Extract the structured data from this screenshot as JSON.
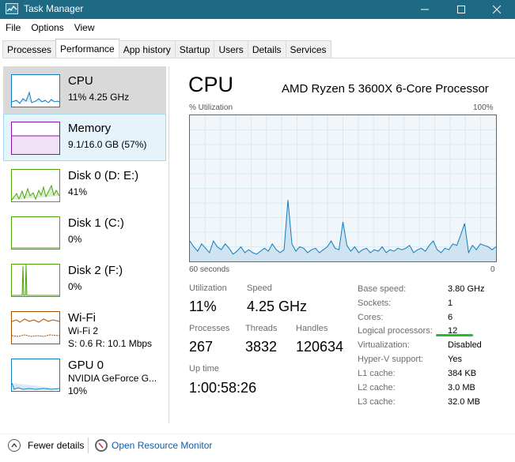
{
  "window": {
    "title": "Task Manager"
  },
  "menu": [
    "File",
    "Options",
    "View"
  ],
  "tabs": [
    "Processes",
    "Performance",
    "App history",
    "Startup",
    "Users",
    "Details",
    "Services"
  ],
  "sidebar": [
    {
      "name": "CPU",
      "sub": "11%  4.25 GHz"
    },
    {
      "name": "Memory",
      "sub": "9.1/16.0 GB (57%)"
    },
    {
      "name": "Disk 0 (D: E:)",
      "sub": "41%"
    },
    {
      "name": "Disk 1 (C:)",
      "sub": "0%"
    },
    {
      "name": "Disk 2 (F:)",
      "sub": "0%"
    },
    {
      "name": "Wi-Fi",
      "sub": "Wi-Fi 2",
      "sub2": "S: 0.6  R: 10.1 Mbps"
    },
    {
      "name": "GPU 0",
      "sub": "NVIDIA GeForce G...",
      "sub2": "10%"
    }
  ],
  "main": {
    "title": "CPU",
    "model": "AMD Ryzen 5 3600X 6-Core Processor",
    "util_label": "% Utilization",
    "util_max": "100%",
    "x_left": "60 seconds",
    "x_right": "0",
    "stats": {
      "utilization_label": "Utilization",
      "utilization": "11%",
      "speed_label": "Speed",
      "speed": "4.25 GHz",
      "processes_label": "Processes",
      "processes": "267",
      "threads_label": "Threads",
      "threads": "3832",
      "handles_label": "Handles",
      "handles": "120634",
      "uptime_label": "Up time",
      "uptime": "1:00:58:26"
    },
    "specs": [
      {
        "label": "Base speed:",
        "value": "3.80 GHz"
      },
      {
        "label": "Sockets:",
        "value": "1"
      },
      {
        "label": "Cores:",
        "value": "6"
      },
      {
        "label": "Logical processors:",
        "value": "12"
      },
      {
        "label": "Virtualization:",
        "value": "Disabled"
      },
      {
        "label": "Hyper-V support:",
        "value": "Yes"
      },
      {
        "label": "L1 cache:",
        "value": "384 KB"
      },
      {
        "label": "L2 cache:",
        "value": "3.0 MB"
      },
      {
        "label": "L3 cache:",
        "value": "32.0 MB"
      }
    ]
  },
  "footer": {
    "fewer": "Fewer details",
    "resmon": "Open Resource Monitor"
  },
  "colors": {
    "titlebar": "#1e6a84",
    "cpu": "#117dbb",
    "memory": "#8b12ae",
    "disk": "#4da60c",
    "wifi": "#a74f01",
    "highlight": "#1fc12a"
  },
  "cpu_history": [
    14,
    10,
    7,
    12,
    9,
    6,
    14,
    10,
    8,
    12,
    9,
    5,
    7,
    10,
    6,
    8,
    6,
    5,
    7,
    9,
    7,
    12,
    8,
    6,
    8,
    42,
    12,
    7,
    10,
    9,
    6,
    8,
    9,
    6,
    8,
    10,
    14,
    9,
    8,
    27,
    11,
    7,
    10,
    6,
    8,
    9,
    6,
    8,
    7,
    10,
    6,
    8,
    7,
    9,
    8,
    9,
    11,
    6,
    8,
    9,
    7,
    11,
    14,
    8,
    6,
    9,
    8,
    12,
    11,
    18,
    26,
    6,
    11,
    8,
    12,
    11,
    10,
    8,
    10
  ]
}
